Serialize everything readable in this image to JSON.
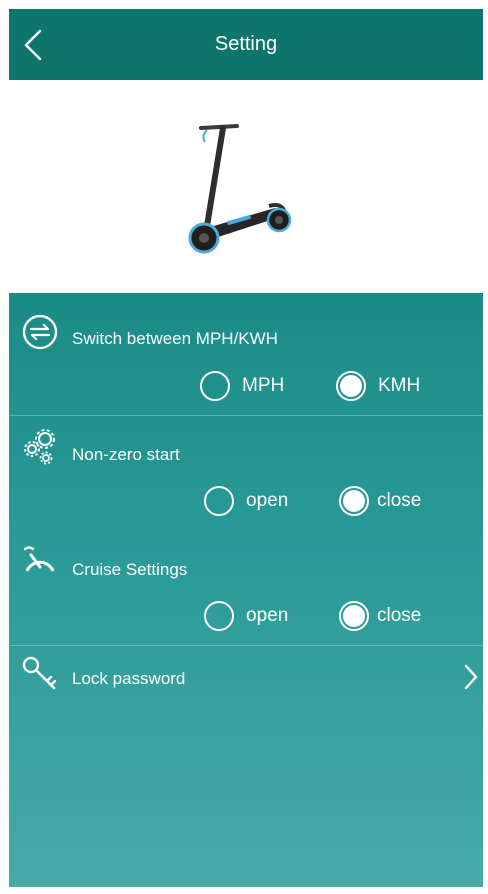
{
  "header": {
    "title": "Setting"
  },
  "settings": {
    "units": {
      "title": "Switch between MPH/KWH",
      "options": [
        "MPH",
        "KMH"
      ],
      "selected": "KMH"
    },
    "nonzero": {
      "title": "Non-zero start",
      "options": [
        "open",
        "close"
      ],
      "selected": "close"
    },
    "cruise": {
      "title": "Cruise Settings",
      "options": [
        "open",
        "close"
      ],
      "selected": "close"
    },
    "lock": {
      "title": "Lock password"
    }
  },
  "colors": {
    "header": "#0e756d",
    "panel_top": "#1b8b87",
    "panel_bottom": "#47a9a8",
    "text": "#ffffff"
  },
  "icons": [
    "back-arrow-icon",
    "switch-arrows-icon",
    "gears-icon",
    "speedometer-icon",
    "key-icon",
    "chevron-right-icon"
  ]
}
